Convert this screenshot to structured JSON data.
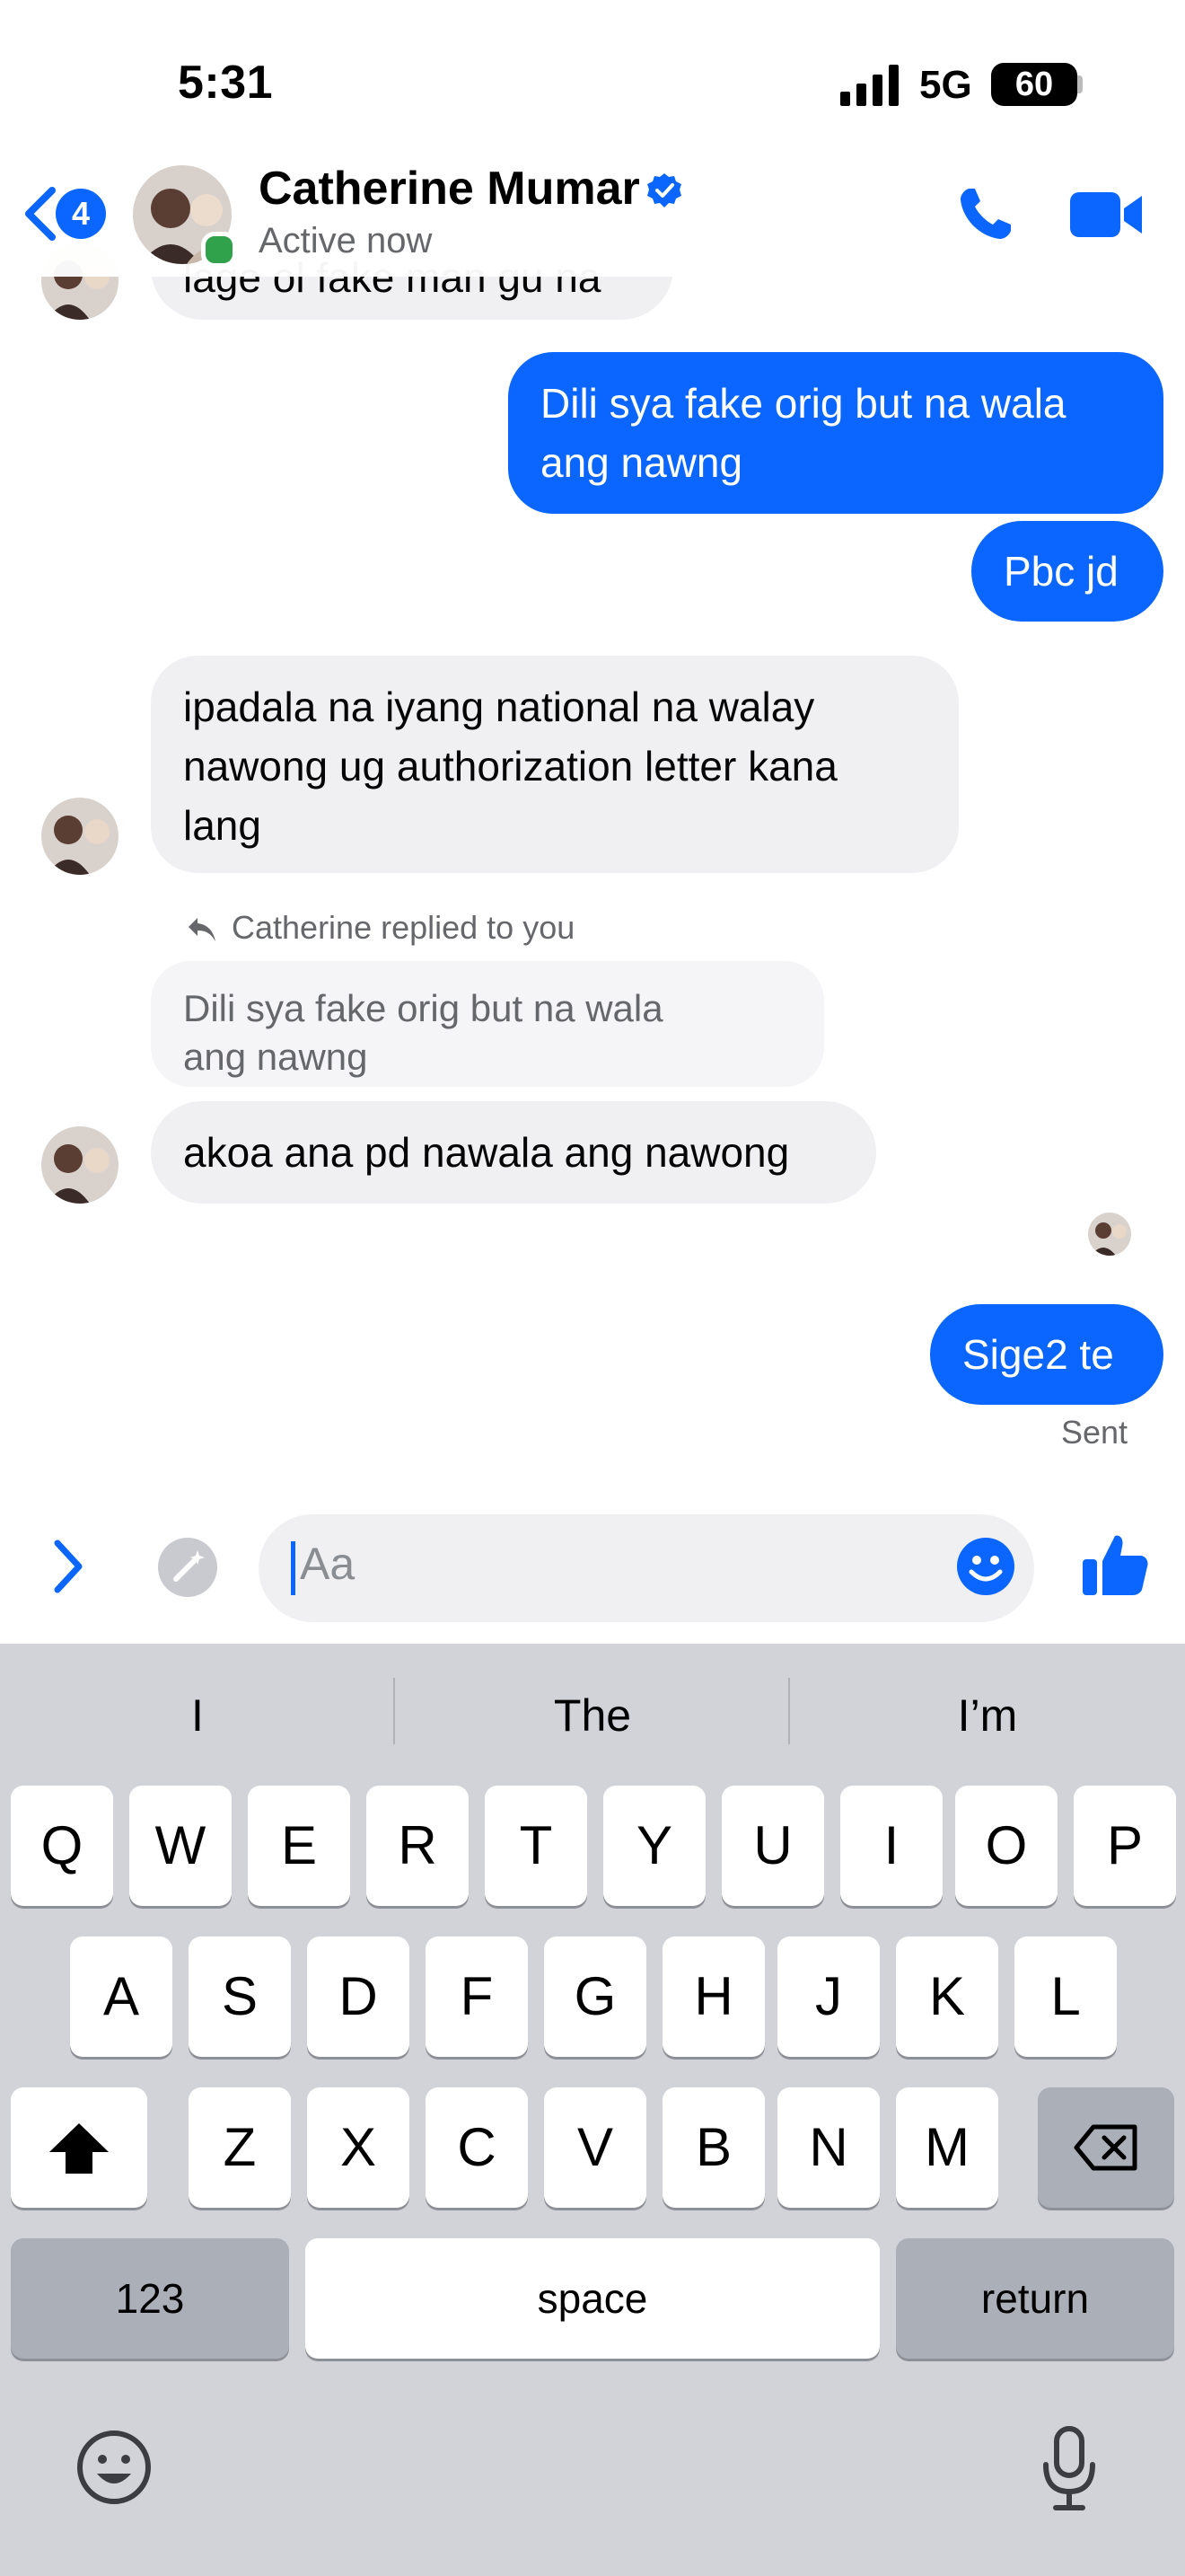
{
  "status_bar": {
    "time": "5:31",
    "network": "5G",
    "battery": "60"
  },
  "header": {
    "back_badge": "4",
    "contact_name": "Catherine Mumar",
    "status": "Active now"
  },
  "messages": {
    "partial_top": "lage ol fake man gu na",
    "m1": [
      "Dili sya fake orig but na wala",
      "ang nawng"
    ],
    "m2": "Pbc jd",
    "m3": [
      "ipadala na iyang national na walay",
      "nawong ug authorization letter kana",
      "lang"
    ],
    "reply_label": "Catherine replied to you",
    "quoted": [
      "Dili sya fake orig but na wala",
      "ang nawng"
    ],
    "m4": "akoa ana pd nawala ang nawong",
    "m5": "Sige2 te",
    "sent_label": "Sent"
  },
  "composer": {
    "placeholder": "Aa"
  },
  "keyboard": {
    "suggestions": [
      "I",
      "The",
      "I’m"
    ],
    "row1": [
      "Q",
      "W",
      "E",
      "R",
      "T",
      "Y",
      "U",
      "I",
      "O",
      "P"
    ],
    "row2": [
      "A",
      "S",
      "D",
      "F",
      "G",
      "H",
      "J",
      "K",
      "L"
    ],
    "row3": [
      "Z",
      "X",
      "C",
      "V",
      "B",
      "N",
      "M"
    ],
    "numbers_key": "123",
    "space_key": "space",
    "return_key": "return"
  },
  "colors": {
    "accent": "#0a66ff",
    "incoming_bubble": "#f0f0f3",
    "keyboard_bg": "#d1d3d9",
    "online": "#31a24c"
  }
}
